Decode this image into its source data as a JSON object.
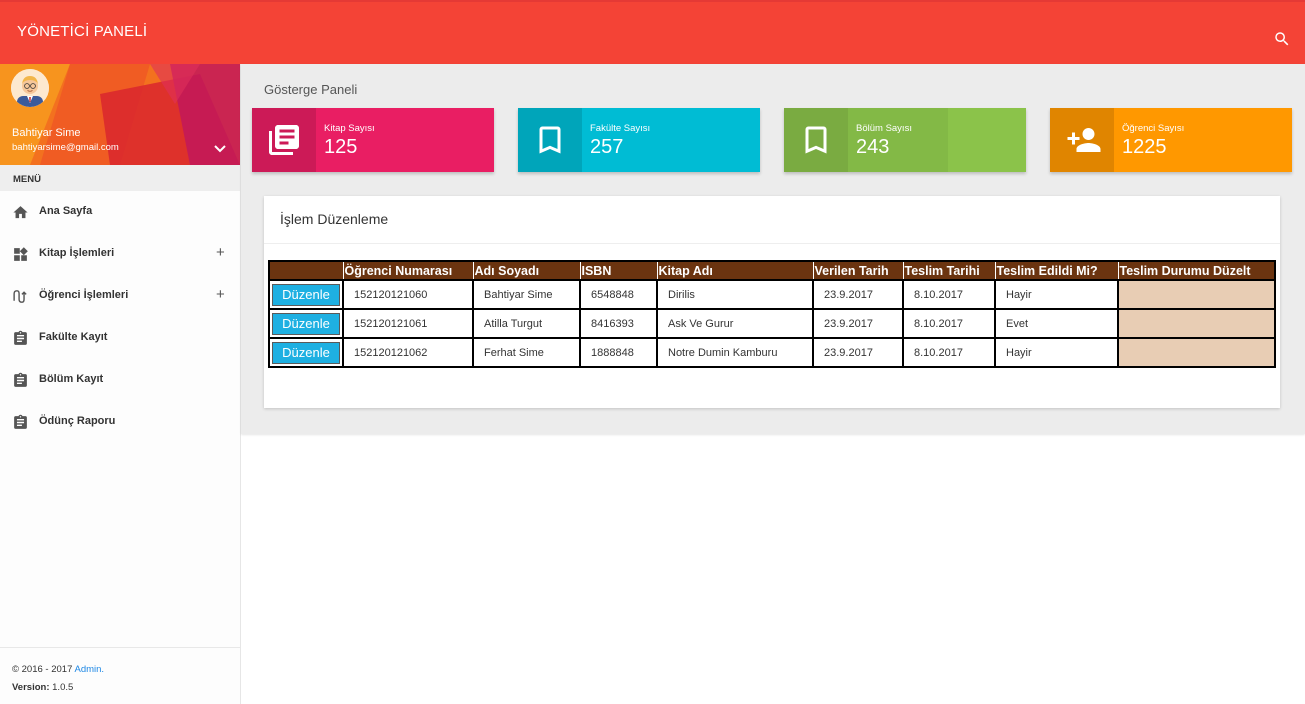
{
  "header": {
    "title": "YÖNETİCİ PANELİ"
  },
  "user": {
    "name": "Bahtiyar Sime",
    "email": "bahtiyarsime@gmail.com"
  },
  "sidebar": {
    "menu_header": "MENÜ",
    "items": [
      {
        "label": "Ana Sayfa",
        "icon": "home-icon",
        "expandable": false
      },
      {
        "label": "Kitap İşlemleri",
        "icon": "widgets-icon",
        "expandable": true
      },
      {
        "label": "Öğrenci İşlemleri",
        "icon": "timeline-icon",
        "expandable": true
      },
      {
        "label": "Fakülte Kayıt",
        "icon": "clipboard-icon",
        "expandable": false
      },
      {
        "label": "Bölüm Kayıt",
        "icon": "clipboard-icon",
        "expandable": false
      },
      {
        "label": "Ödünç Raporu",
        "icon": "clipboard-icon",
        "expandable": false
      }
    ],
    "expand_symbol": "+"
  },
  "footer": {
    "copyright": "© 2016 - 2017",
    "link": "Admin.",
    "version_label": "Version:",
    "version": "1.0.5"
  },
  "main": {
    "page_title": "Gösterge Paneli",
    "info_boxes": [
      {
        "label": "Kitap Sayısı",
        "value": "125",
        "icon": "library-books-icon",
        "color": "#e91e63"
      },
      {
        "label": "Fakülte Sayısı",
        "value": "257",
        "icon": "bookmark-icon",
        "color": "#00bcd4"
      },
      {
        "label": "Bölüm Sayısı",
        "value": "243",
        "icon": "bookmark-icon",
        "color": "#8bc34a"
      },
      {
        "label": "Öğrenci Sayısı",
        "value": "1225",
        "icon": "person-add-icon",
        "color": "#ff9800"
      }
    ],
    "card_title": "İşlem Düzenleme",
    "table": {
      "headers": [
        "",
        "Öğrenci Numarası",
        "Adı Soyadı",
        "ISBN",
        "Kitap Adı",
        "Verilen Tarih",
        "Teslim Tarihi",
        "Teslim Edildi Mi?",
        "Teslim Durumu Düzelt"
      ],
      "edit_label": "Düzenle",
      "rows": [
        {
          "ogrenci_no": "152120121060",
          "ad_soyad": "Bahtiyar Sime",
          "isbn": "6548848",
          "kitap_adi": "Dirilis",
          "verilen": "23.9.2017",
          "teslim": "8.10.2017",
          "durum": "Hayir"
        },
        {
          "ogrenci_no": "152120121061",
          "ad_soyad": "Atilla Turgut",
          "isbn": "8416393",
          "kitap_adi": "Ask Ve Gurur",
          "verilen": "23.9.2017",
          "teslim": "8.10.2017",
          "durum": "Evet"
        },
        {
          "ogrenci_no": "152120121062",
          "ad_soyad": "Ferhat Sime",
          "isbn": "1888848",
          "kitap_adi": "Notre Dumin Kamburu",
          "verilen": "23.9.2017",
          "teslim": "8.10.2017",
          "durum": "Hayir"
        }
      ]
    }
  },
  "colors": {
    "topbar": "#f44336",
    "table_header": "#6b3410",
    "edit_button": "#1eb0e2",
    "fix_cell": "#e8cdb4",
    "accent": "#1e88e5"
  }
}
